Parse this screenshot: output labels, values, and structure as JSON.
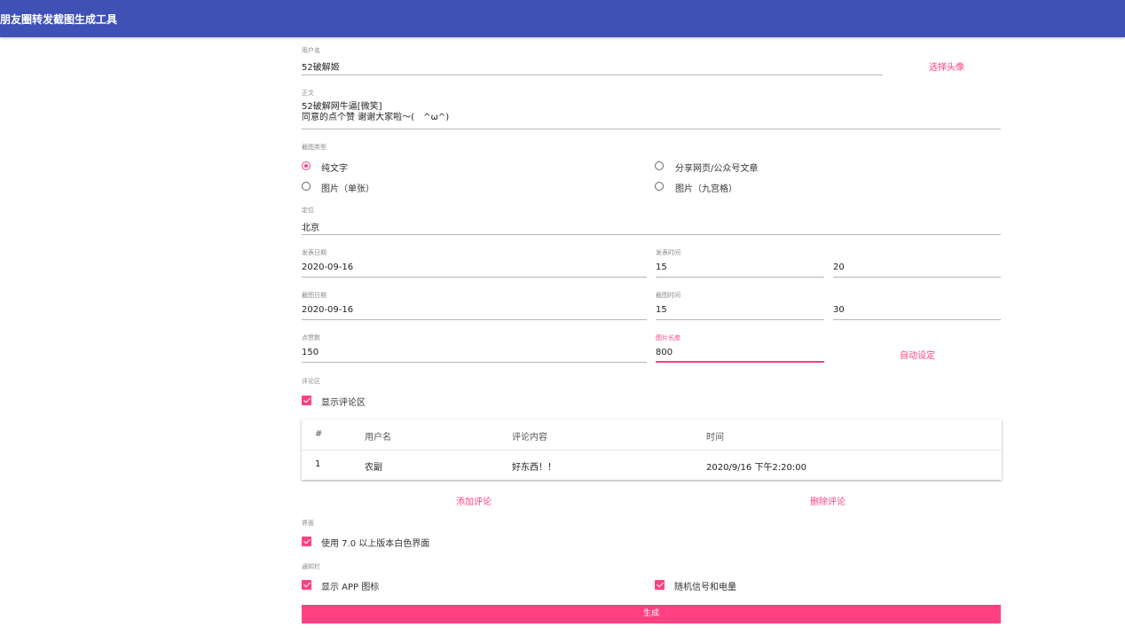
{
  "app": {
    "title": "朋友圈转发截图生成工具"
  },
  "username": {
    "label": "用户名",
    "value": "52破解姬"
  },
  "avatar_button": "选择头像",
  "body": {
    "label": "正文",
    "line1": "52破解网牛逼[微笑]",
    "line2": "同意的点个赞 谢谢大家啦～(　^ω^)"
  },
  "screenshot_type": {
    "label": "截图类型",
    "options": [
      "纯文字",
      "分享网页/公众号文章",
      "图片（单张）",
      "图片（九宫格）"
    ],
    "selected": "纯文字"
  },
  "location": {
    "label": "定位",
    "value": "北京"
  },
  "publish": {
    "date_label": "发表日期",
    "date": "2020-09-16",
    "time_label": "发表时间",
    "hour": "15",
    "minute": "20"
  },
  "capture": {
    "date_label": "截图日期",
    "date": "2020-09-16",
    "time_label": "截图时间",
    "hour": "15",
    "minute": "30"
  },
  "likes": {
    "label": "点赞数",
    "value": "150"
  },
  "image_length": {
    "label": "图片长度",
    "value": "800"
  },
  "auto_set_button": "自动设定",
  "comments": {
    "section_label": "评论区",
    "show_label": "显示评论区",
    "show_checked": true,
    "headers": [
      "#",
      "用户名",
      "评论内容",
      "时间"
    ],
    "rows": [
      {
        "index": "1",
        "user": "农副",
        "content": "好东西！！",
        "time": "2020/9/16 下午2:20:00"
      }
    ],
    "add_button": "添加评论",
    "delete_button": "删除评论"
  },
  "ui": {
    "section_label": "界面",
    "white_ui_label": "使用 7.0 以上版本白色界面",
    "white_ui_checked": true
  },
  "notification": {
    "section_label": "通知栏",
    "show_app_icon_label": "显示 APP 图标",
    "show_app_icon_checked": true,
    "random_signal_label": "随机信号和电量",
    "random_signal_checked": true
  },
  "generate_button": "生成",
  "colors": {
    "primary": "#3f51b5",
    "accent": "#ff4081"
  }
}
